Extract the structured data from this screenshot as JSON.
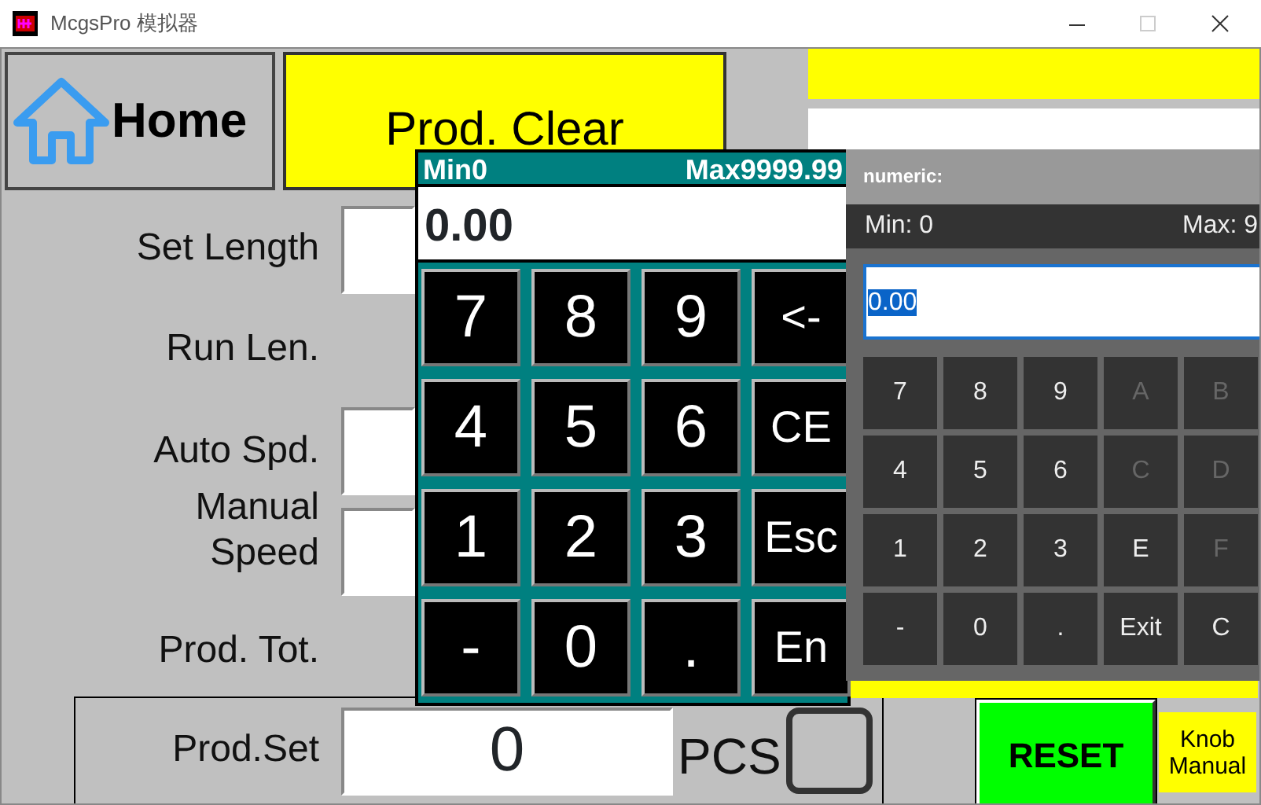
{
  "window": {
    "title": "McgsPro 模拟器"
  },
  "home_button": {
    "label": "Home"
  },
  "prod_clear_button": {
    "label": "Prod. Clear"
  },
  "fields": [
    {
      "label": "Set Length",
      "kind": "input"
    },
    {
      "label": "Run Len.",
      "kind": "display"
    },
    {
      "label": "Auto Spd.",
      "kind": "input"
    },
    {
      "label": "Manual\nSpeed",
      "kind": "input"
    },
    {
      "label": "Prod. Tot.",
      "kind": "display"
    }
  ],
  "prod_set": {
    "label": "Prod.Set",
    "value": "0",
    "unit": "PCS"
  },
  "reset_button": {
    "label": "RESET"
  },
  "knob_manual": {
    "label": "Knob\nManual"
  },
  "keypad": {
    "min": "Min0",
    "max": "Max9999.99",
    "value": "0.00",
    "keys": [
      "7",
      "8",
      "9",
      "<-",
      "4",
      "5",
      "6",
      "CE",
      "1",
      "2",
      "3",
      "Esc",
      "-",
      "0",
      ".",
      "En"
    ]
  },
  "numeric_dialog": {
    "title": "numeric:",
    "min": "Min: 0",
    "max": "Max: 9",
    "value": "0.00",
    "keys": [
      {
        "label": "7",
        "disabled": false
      },
      {
        "label": "8",
        "disabled": false
      },
      {
        "label": "9",
        "disabled": false
      },
      {
        "label": "A",
        "disabled": true
      },
      {
        "label": "B",
        "disabled": true
      },
      {
        "label": "4",
        "disabled": false
      },
      {
        "label": "5",
        "disabled": false
      },
      {
        "label": "6",
        "disabled": false
      },
      {
        "label": "C",
        "disabled": true
      },
      {
        "label": "D",
        "disabled": true
      },
      {
        "label": "1",
        "disabled": false
      },
      {
        "label": "2",
        "disabled": false
      },
      {
        "label": "3",
        "disabled": false
      },
      {
        "label": "E",
        "disabled": false
      },
      {
        "label": "F",
        "disabled": true
      },
      {
        "label": "-",
        "disabled": false
      },
      {
        "label": "0",
        "disabled": false
      },
      {
        "label": ".",
        "disabled": false
      },
      {
        "label": "Exit",
        "disabled": false
      },
      {
        "label": "C",
        "disabled": false
      }
    ]
  }
}
